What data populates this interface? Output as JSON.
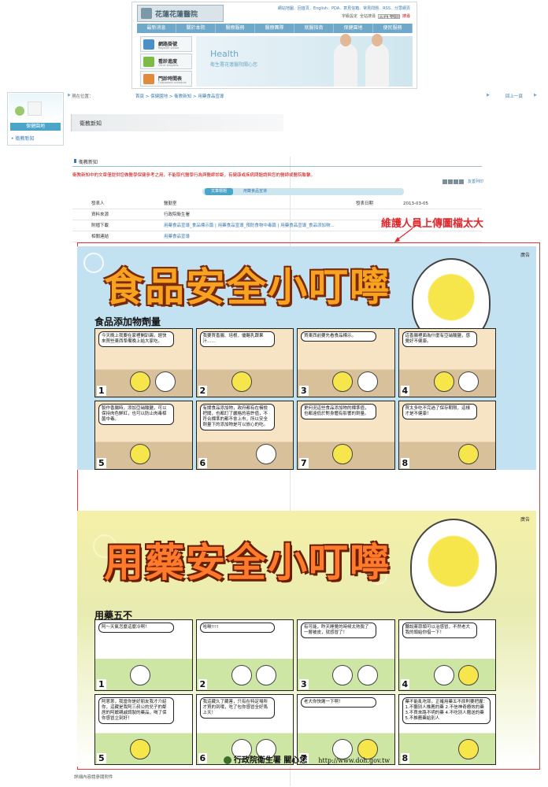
{
  "header": {
    "logo_text": "花蓮花蓮醫院",
    "links": "網站地圖．回首頁．English．PDA．意見信箱．常見問題．RSS．分眾網頁",
    "font_label": "字級設定",
    "search_label": "全站搜尋",
    "search_placeholder": "請輸入關鍵字",
    "search_go": "搜尋",
    "nav": [
      "最新消息",
      "關於本院",
      "醫療服務",
      "醫療團隊",
      "就醫指南",
      "保健園地",
      "便民服務"
    ],
    "side_buttons": [
      {
        "title": "網路掛號",
        "sub": "Register online"
      },
      {
        "title": "看診進度",
        "sub": "Clinic progress"
      },
      {
        "title": "門診時間表",
        "sub": "Outpatient schedule"
      }
    ],
    "banner_title": "Health",
    "banner_sub": "衛生署花蓮醫院關心您"
  },
  "sidebar": {
    "heading": "保健園地",
    "items": [
      "衛教新知"
    ]
  },
  "breadcrumb": {
    "location": "現在位置：",
    "path": "首頁 > 保健園地 > 衛教新知 > 用藥食品宣導",
    "back": "回上一頁"
  },
  "page_title": "衛教新知",
  "section_title": "衛教新知",
  "notice": "衛教新知中的文章僅提供您做醫學保健參考之用，不能取代醫學行為與醫師診斷，有健康或疾病問題請與您的醫師或醫院聯繫。",
  "tools_label": "友善列印",
  "tabs": [
    "文章標題",
    "用藥食品宣導"
  ],
  "info": {
    "publisher_label": "發表人",
    "publisher": "醫勤室",
    "date_label": "發表日期",
    "date": "2013-03-05",
    "source_label": "資料來源",
    "source": "行政院衛生署",
    "attachment_label": "附檔下載",
    "attachment": "用藥食品宣導_食品標示篇 | 用藥食品宣導_預防食物中毒篇 | 用藥食品宣導_食品添加物...",
    "link_label": "相關連結",
    "link": "用藥食品宣導"
  },
  "annotation": "維護人員上傳圖檔太大",
  "poster1": {
    "ad": "廣告",
    "title": "食品安全小叮嚀",
    "subtitle": "食品添加物劑量",
    "panels": [
      {
        "text": "今天晚上我要在家裡開趴踢，趕快來買些東西準備晚上給大家吃。",
        "num": "1"
      },
      {
        "text": "我要買香腸、培根、優酪乳跟果汁……",
        "num": "2"
      },
      {
        "text": "買東西前要先看食品標示。",
        "num": "3"
      },
      {
        "text": "這香腸裡面為什麼有亞硝酸鹽，感覺好不健康。",
        "num": "4"
      },
      {
        "text": "製作香腸時，添加亞硝酸鹽，可以保持肉色鮮紅，也可以防止肉毒桿菌中毒。",
        "num": "5"
      },
      {
        "text": "有關食品添加物，政府都有在橫檢把關，也都訂了嚴格的容許值，不符合標準的都不會上市，所以安全劑量下的添加物是可以放心的吃。",
        "num": "6"
      },
      {
        "text": "更何況這些食品添加物的標準值，也都遠低於對身體有影響的劑量。",
        "num": "7"
      },
      {
        "text": "買太多吃不完過了保存期限，這樣才是不健康！",
        "num": "8"
      }
    ]
  },
  "poster2": {
    "ad": "廣告",
    "title": "用藥安全小叮嚀",
    "subtitle": "用藥五不",
    "panels": [
      {
        "text": "阿～天氣怎麼這麼冷啊！",
        "num": "1"
      },
      {
        "text": "哈啾!!!!",
        "num": "2"
      },
      {
        "text": "有可能，昨天睡覺的時候太熱脫了一層被皮，就感冒了！",
        "num": "3"
      },
      {
        "text": "聽說蔣蒜頭可以治感冒，不然老大我的頭給你借一下！",
        "num": "4"
      },
      {
        "text": "阿蔥蔥，我當你是好朋友我才介紹你，這藏是我阿三叔公的兒子的鄰居的阿嬤親戚調製的藥品，喝了保你感冒立刻好！",
        "num": "5"
      },
      {
        "text": "我這藏久了藏害，只有在特定場所才買的到哦，吃了包你感冒全好馬上天！",
        "num": "6"
      },
      {
        "text": "老大你快謝一下啊！",
        "num": "7"
      },
      {
        "text": "藥不能亂吃耶，正確用藥五不原則要把握：1.不聽別人推薦的藥 2.不信神奇療效的藥 3.不買來路不明的藥 4.不吃別人贈送的藥 5.不推薦藥給別人",
        "num": "8"
      }
    ],
    "sign": "行政院衛生署 關心您",
    "url": "http://www.doh.gov.tw"
  },
  "footer_note": "詳細內容請參閱附件"
}
